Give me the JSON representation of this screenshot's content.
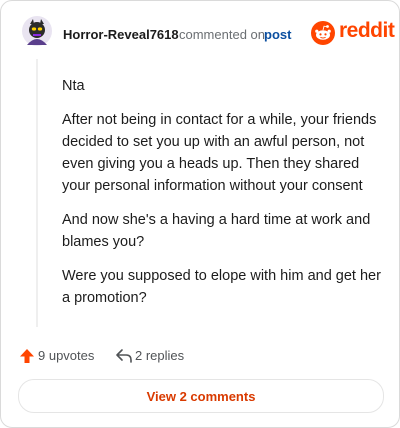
{
  "comment": {
    "username": "Horror-Reveal7618",
    "commented_on": "commented on",
    "post_link": "post",
    "paragraphs": [
      "Nta",
      "After not being in contact for a while, your friends decided to set you up with an awful person, not even giving you a heads up. Then they shared your personal information without your consent",
      "And now she's a having a hard time at work and blames you?",
      "Were you supposed to elope with him and get her a promotion?"
    ]
  },
  "brand": {
    "name": "reddit",
    "icon": "reddit-snoo-icon",
    "color": "#ff4500"
  },
  "actions": {
    "upvotes": "9 upvotes",
    "replies": "2 replies",
    "upvote_icon": "upvote-arrow-icon",
    "reply_icon": "reply-arrow-icon",
    "upvote_color": "#ff4500"
  },
  "footer": {
    "view_comments": "View 2 comments",
    "accent": "#d93a00"
  }
}
